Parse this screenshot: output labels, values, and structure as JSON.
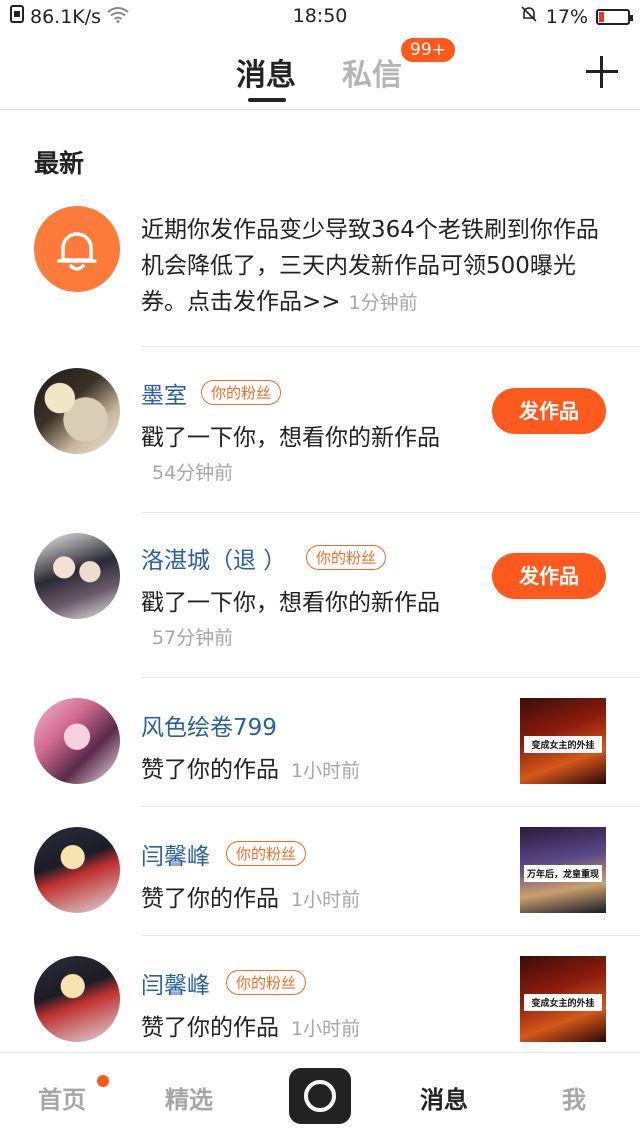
{
  "status_bar": {
    "network_speed": "86.1K/s",
    "time": "18:50",
    "battery": "17%",
    "battery_level": 0.17,
    "icons": [
      "sim-icon",
      "wifi-icon",
      "mute-bell-icon",
      "battery-icon"
    ]
  },
  "top_tabs": {
    "messages": "消息",
    "private_messages": "私信",
    "private_badge": "99+",
    "add_icon": "plus-icon"
  },
  "section_title": "最新",
  "notice": {
    "icon": "bell-icon",
    "text": "近期你发作品变少导致364个老铁刷到你作品机会降低了，三天内发新作品可领500曝光券。点击发作品>>",
    "time": "1分钟前"
  },
  "items": [
    {
      "name": "墨室",
      "tag": "你的粉丝",
      "action": "戳了一下你，想看你的新作品",
      "time": "54分钟前",
      "button": "发作品"
    },
    {
      "name": "洛湛城（退 ）",
      "tag": "你的粉丝",
      "action": "戳了一下你，想看你的新作品",
      "time": "57分钟前",
      "button": "发作品"
    },
    {
      "name": "风色绘卷799",
      "action": "赞了你的作品",
      "time": "1小时前",
      "thumb_caption": "变成女主的外挂"
    },
    {
      "name": "闫馨峰",
      "tag": "你的粉丝",
      "action": "赞了你的作品",
      "time": "1小时前",
      "thumb_caption": "万年后，龙皇重现"
    },
    {
      "name": "闫馨峰",
      "tag": "你的粉丝",
      "action": "赞了你的作品",
      "time": "1小时前",
      "thumb_caption": "变成女主的外挂"
    }
  ],
  "bottom_nav": {
    "home": "首页",
    "featured": "精选",
    "messages": "消息",
    "me": "我",
    "camera_icon": "camera-icon"
  },
  "colors": {
    "accent": "#fe5a1e",
    "link": "#2b5f9c",
    "muted": "#a6a6a6"
  }
}
